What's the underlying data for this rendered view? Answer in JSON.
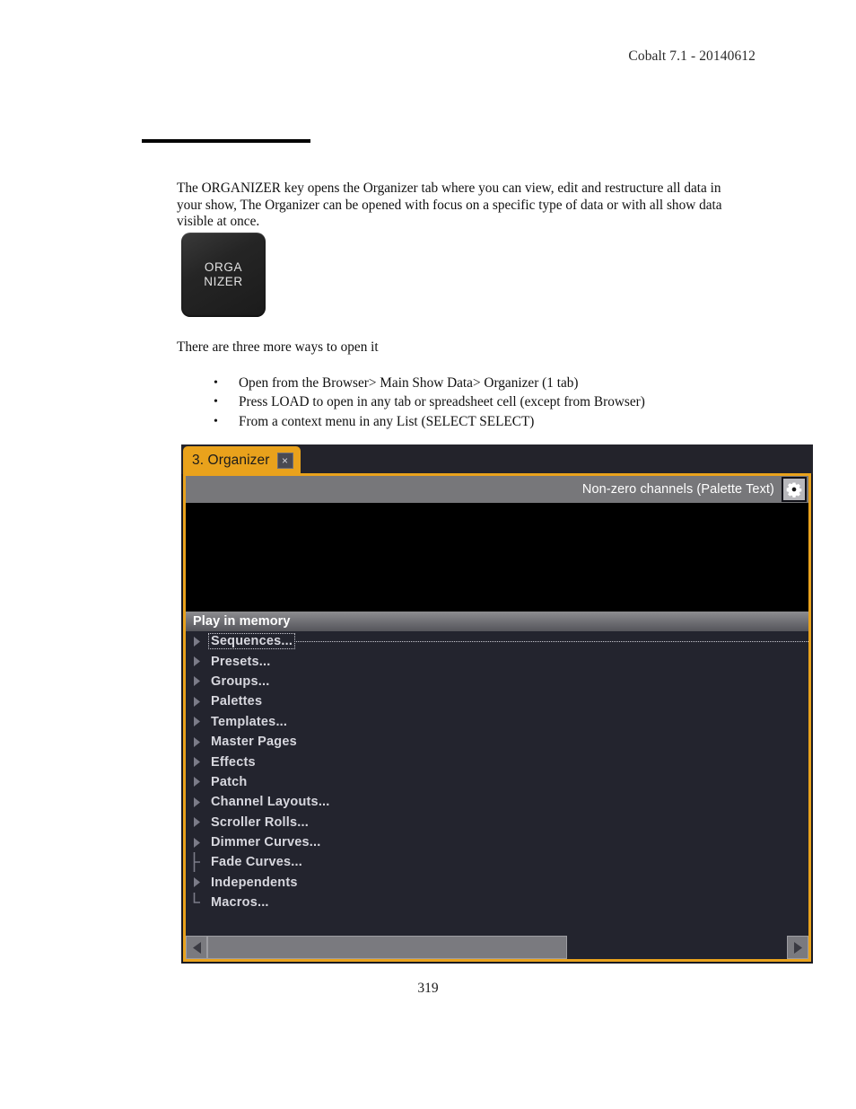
{
  "document": {
    "header": "Cobalt 7.1 - 20140612",
    "page_number": "319",
    "intro_paragraph": "The ORGANIZER key opens the Organizer tab where you can view, edit and restructure all data in your show, The Organizer can be opened with focus on a specific type of data or with all show data visible at once.",
    "key_button": {
      "line1": "ORGA",
      "line2": "NIZER"
    },
    "ways_lead": "There are three more ways to open it",
    "bullet_char": "•",
    "ways": [
      "Open from the Browser> Main Show Data> Organizer (1 tab)",
      "Press LOAD to open in any tab or spreadsheet cell (except from Browser)",
      "From a context menu in any List (SELECT SELECT)"
    ]
  },
  "ui": {
    "tab": {
      "label": "3. Organizer",
      "close_label": "×"
    },
    "toolbar": {
      "title": "Non-zero channels (Palette Text)",
      "gear_icon": "gear-icon"
    },
    "section": {
      "header": "Play in memory"
    },
    "tree_items": [
      {
        "label": "Sequences...",
        "marker": "triangle",
        "selected": true
      },
      {
        "label": "Presets...",
        "marker": "triangle",
        "selected": false
      },
      {
        "label": "Groups...",
        "marker": "triangle",
        "selected": false
      },
      {
        "label": "Palettes",
        "marker": "triangle",
        "selected": false
      },
      {
        "label": "Templates...",
        "marker": "triangle",
        "selected": false
      },
      {
        "label": "Master Pages",
        "marker": "triangle",
        "selected": false
      },
      {
        "label": "Effects",
        "marker": "triangle",
        "selected": false
      },
      {
        "label": "Patch",
        "marker": "triangle",
        "selected": false
      },
      {
        "label": "Channel Layouts...",
        "marker": "triangle",
        "selected": false
      },
      {
        "label": "Scroller Rolls...",
        "marker": "triangle",
        "selected": false
      },
      {
        "label": "Dimmer Curves...",
        "marker": "triangle",
        "selected": false
      },
      {
        "label": "Fade Curves...",
        "marker": "tee",
        "selected": false
      },
      {
        "label": "Independents",
        "marker": "triangle",
        "selected": false
      },
      {
        "label": "Macros...",
        "marker": "corner",
        "selected": false
      }
    ],
    "scrollbar": {
      "left_arrow": "left-arrow-icon",
      "right_arrow": "right-arrow-icon",
      "thumb_percent": 62
    },
    "colors": {
      "accent_orange": "#e9a21c",
      "panel_dark": "#23242e",
      "toolbar_gray": "#77777a",
      "canvas_black": "#000000"
    }
  }
}
